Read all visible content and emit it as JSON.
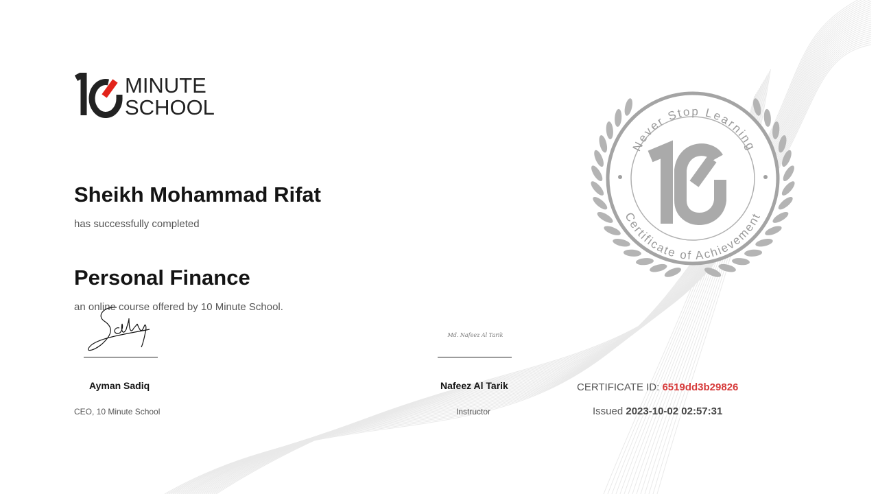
{
  "logo": {
    "number": "10",
    "word1": "MINUTE",
    "word2": "SCHOOL",
    "accent_color": "#e2231a"
  },
  "recipient": {
    "name": "Sheikh Mohammad Rifat",
    "completed_text": "has successfully completed"
  },
  "course": {
    "title": "Personal Finance",
    "description": "an online course offered by 10 Minute School."
  },
  "signatories": [
    {
      "name": "Ayman Sadiq",
      "role": "CEO, 10 Minute School"
    },
    {
      "name": "Nafeez Al Tarik",
      "role": "Instructor",
      "signature_text": "Md. Nafeez Al Tarik"
    }
  ],
  "seal": {
    "top_text": "Never Stop Learning",
    "bottom_text": "Certificate of Achievement",
    "center": "10",
    "color": "#9a9a9a"
  },
  "certificate": {
    "id_label": "CERTIFICATE ID:",
    "id_value": "6519dd3b29826",
    "id_color": "#d63a3a",
    "issued_label": "Issued",
    "issued_value": "2023-10-02 02:57:31"
  },
  "icons": [
    "laurel-wreath-icon"
  ]
}
